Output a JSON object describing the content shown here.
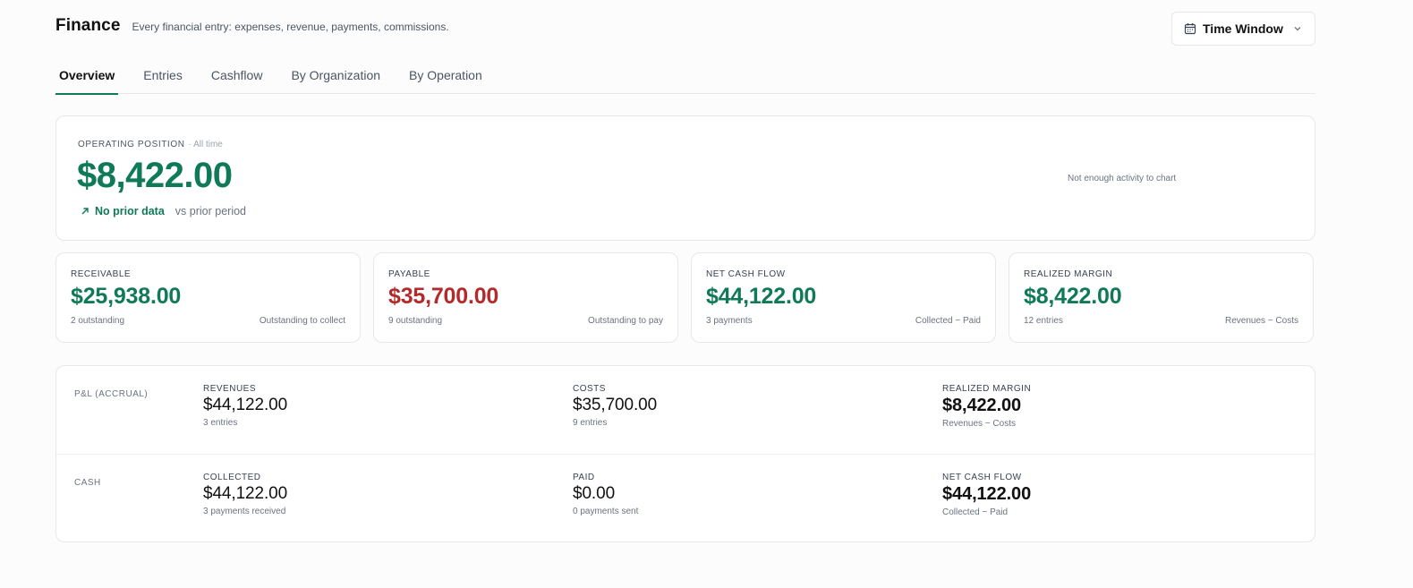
{
  "header": {
    "title": "Finance",
    "subtitle": "Every financial entry: expenses, revenue, payments, commissions.",
    "time_window_label": "Time Window"
  },
  "tabs": [
    {
      "label": "Overview",
      "active": true
    },
    {
      "label": "Entries",
      "active": false
    },
    {
      "label": "Cashflow",
      "active": false
    },
    {
      "label": "By Organization",
      "active": false
    },
    {
      "label": "By Operation",
      "active": false
    }
  ],
  "operating": {
    "label": "OPERATING POSITION",
    "scope": "· All time",
    "value": "$8,422.00",
    "trend_value": "No prior data",
    "trend_note": "vs prior period",
    "chart_message": "Not enough activity to chart"
  },
  "kpis": [
    {
      "label": "RECEIVABLE",
      "value": "$25,938.00",
      "foot_left": "2 outstanding",
      "foot_right": "Outstanding to collect",
      "color": "#0f7a55"
    },
    {
      "label": "PAYABLE",
      "value": "$35,700.00",
      "foot_left": "9 outstanding",
      "foot_right": "Outstanding to pay",
      "color": "#b42a2a"
    },
    {
      "label": "NET CASH FLOW",
      "value": "$44,122.00",
      "foot_left": "3 payments",
      "foot_right": "Collected − Paid",
      "color": "#0f7a55"
    },
    {
      "label": "REALIZED MARGIN",
      "value": "$8,422.00",
      "foot_left": "12 entries",
      "foot_right": "Revenues − Costs",
      "color": "#0f7a55"
    }
  ],
  "pl": {
    "accrual": {
      "label": "P&L (ACCRUAL)",
      "revenues": {
        "label": "REVENUES",
        "value": "$44,122.00",
        "sub": "3 entries"
      },
      "costs": {
        "label": "COSTS",
        "value": "$35,700.00",
        "sub": "9 entries"
      },
      "margin": {
        "label": "REALIZED MARGIN",
        "value": "$8,422.00",
        "sub": "Revenues − Costs"
      }
    },
    "cash": {
      "label": "CASH",
      "collected": {
        "label": "COLLECTED",
        "value": "$44,122.00",
        "sub": "3 payments received"
      },
      "paid": {
        "label": "PAID",
        "value": "$0.00",
        "sub": "0 payments sent"
      },
      "net": {
        "label": "NET CASH FLOW",
        "value": "$44,122.00",
        "sub": "Collected − Paid"
      }
    }
  },
  "icons": {
    "calendar": "calendar-icon",
    "chevron": "chevron-down-icon",
    "trend": "arrow-up-right-icon"
  }
}
